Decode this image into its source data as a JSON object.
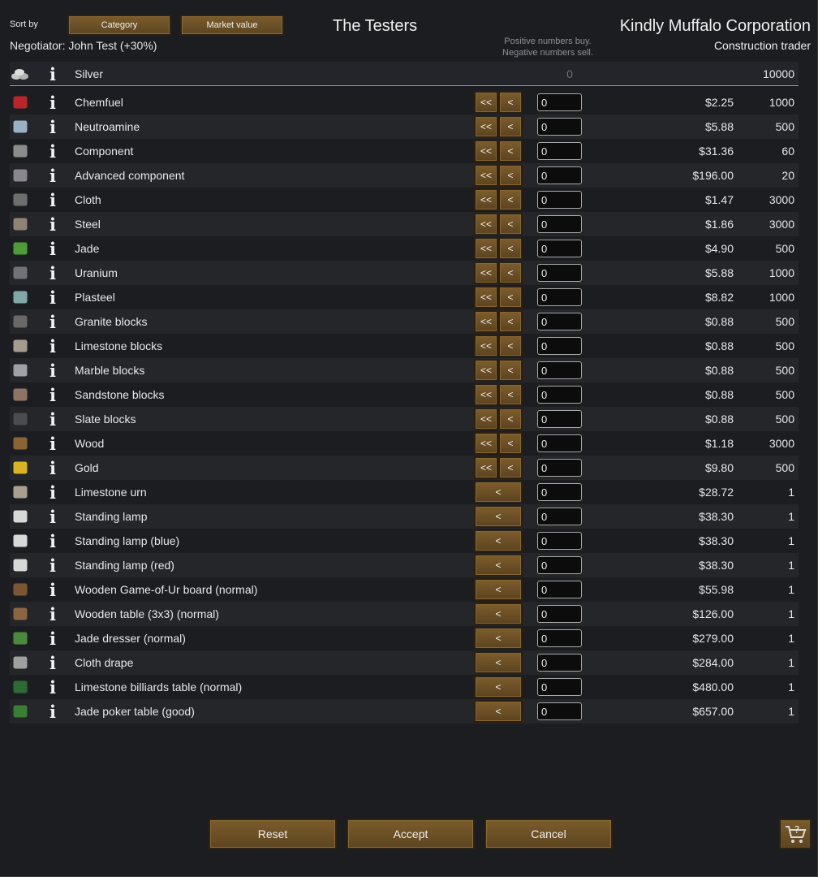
{
  "header": {
    "sort_label": "Sort by",
    "sort_buttons": [
      "Category",
      "Market value"
    ],
    "negotiator": "Negotiator: John Test (+30%)",
    "colony_name": "The Testers",
    "hint_line1": "Positive numbers buy.",
    "hint_line2": "Negative numbers sell.",
    "trader_name": "Kindly Muffalo Corporation",
    "trader_type": "Construction trader"
  },
  "silver": {
    "name": "Silver",
    "colony_count": "0",
    "trader_stock": "10000"
  },
  "arrows": {
    "double": "<<",
    "single": "<"
  },
  "items": [
    {
      "name": "Chemfuel",
      "price": "$2.25",
      "stock": "1000",
      "qty": "0",
      "double": true,
      "icon": "chemfuel-icon",
      "color": "#b8252a"
    },
    {
      "name": "Neutroamine",
      "price": "$5.88",
      "stock": "500",
      "qty": "0",
      "double": true,
      "icon": "neutroamine-icon",
      "color": "#9ab0c4"
    },
    {
      "name": "Component",
      "price": "$31.36",
      "stock": "60",
      "qty": "0",
      "double": true,
      "icon": "component-icon",
      "color": "#8c8c8c"
    },
    {
      "name": "Advanced component",
      "price": "$196.00",
      "stock": "20",
      "qty": "0",
      "double": true,
      "icon": "advanced-component-icon",
      "color": "#8a8690"
    },
    {
      "name": "Cloth",
      "price": "$1.47",
      "stock": "3000",
      "qty": "0",
      "double": true,
      "icon": "cloth-icon",
      "color": "#6e6e6e"
    },
    {
      "name": "Steel",
      "price": "$1.86",
      "stock": "3000",
      "qty": "0",
      "double": true,
      "icon": "steel-icon",
      "color": "#8f8276"
    },
    {
      "name": "Jade",
      "price": "$4.90",
      "stock": "500",
      "qty": "0",
      "double": true,
      "icon": "jade-icon",
      "color": "#4e9b3a"
    },
    {
      "name": "Uranium",
      "price": "$5.88",
      "stock": "1000",
      "qty": "0",
      "double": true,
      "icon": "uranium-icon",
      "color": "#6f7378"
    },
    {
      "name": "Plasteel",
      "price": "$8.82",
      "stock": "1000",
      "qty": "0",
      "double": true,
      "icon": "plasteel-icon",
      "color": "#7fa8a6"
    },
    {
      "name": "Granite blocks",
      "price": "$0.88",
      "stock": "500",
      "qty": "0",
      "double": true,
      "icon": "granite-blocks-icon",
      "color": "#6a6766"
    },
    {
      "name": "Limestone blocks",
      "price": "$0.88",
      "stock": "500",
      "qty": "0",
      "double": true,
      "icon": "limestone-blocks-icon",
      "color": "#a39d90"
    },
    {
      "name": "Marble blocks",
      "price": "$0.88",
      "stock": "500",
      "qty": "0",
      "double": true,
      "icon": "marble-blocks-icon",
      "color": "#9ea2a6"
    },
    {
      "name": "Sandstone blocks",
      "price": "$0.88",
      "stock": "500",
      "qty": "0",
      "double": true,
      "icon": "sandstone-blocks-icon",
      "color": "#8e7464"
    },
    {
      "name": "Slate blocks",
      "price": "$0.88",
      "stock": "500",
      "qty": "0",
      "double": true,
      "icon": "slate-blocks-icon",
      "color": "#4a4c50"
    },
    {
      "name": "Wood",
      "price": "$1.18",
      "stock": "3000",
      "qty": "0",
      "double": true,
      "icon": "wood-icon",
      "color": "#8a6434"
    },
    {
      "name": "Gold",
      "price": "$9.80",
      "stock": "500",
      "qty": "0",
      "double": true,
      "icon": "gold-icon",
      "color": "#d8b424"
    },
    {
      "name": "Limestone urn",
      "price": "$28.72",
      "stock": "1",
      "qty": "0",
      "double": false,
      "icon": "urn-icon",
      "color": "#a89f90"
    },
    {
      "name": "Standing lamp",
      "price": "$38.30",
      "stock": "1",
      "qty": "0",
      "double": false,
      "icon": "standing-lamp-icon",
      "color": "#d8d8d8"
    },
    {
      "name": "Standing lamp (blue)",
      "price": "$38.30",
      "stock": "1",
      "qty": "0",
      "double": false,
      "icon": "standing-lamp-blue-icon",
      "color": "#d8d8d8"
    },
    {
      "name": "Standing lamp (red)",
      "price": "$38.30",
      "stock": "1",
      "qty": "0",
      "double": false,
      "icon": "standing-lamp-red-icon",
      "color": "#d8d8d8"
    },
    {
      "name": "Wooden Game-of-Ur board (normal)",
      "price": "$55.98",
      "stock": "1",
      "qty": "0",
      "double": false,
      "icon": "game-board-icon",
      "color": "#7a5632"
    },
    {
      "name": "Wooden table (3x3) (normal)",
      "price": "$126.00",
      "stock": "1",
      "qty": "0",
      "double": false,
      "icon": "table-icon",
      "color": "#8a6642"
    },
    {
      "name": "Jade dresser (normal)",
      "price": "$279.00",
      "stock": "1",
      "qty": "0",
      "double": false,
      "icon": "dresser-icon",
      "color": "#4b8a3c"
    },
    {
      "name": "Cloth drape",
      "price": "$284.00",
      "stock": "1",
      "qty": "0",
      "double": false,
      "icon": "drape-icon",
      "color": "#a0a0a0"
    },
    {
      "name": "Limestone billiards table (normal)",
      "price": "$480.00",
      "stock": "1",
      "qty": "0",
      "double": false,
      "icon": "billiards-table-icon",
      "color": "#2e6a34"
    },
    {
      "name": "Jade poker table (good)",
      "price": "$657.00",
      "stock": "1",
      "qty": "0",
      "double": false,
      "icon": "poker-table-icon",
      "color": "#3a7d34"
    }
  ],
  "footer": {
    "reset": "Reset",
    "accept": "Accept",
    "cancel": "Cancel",
    "cart_icon": "trade-cart-icon"
  }
}
